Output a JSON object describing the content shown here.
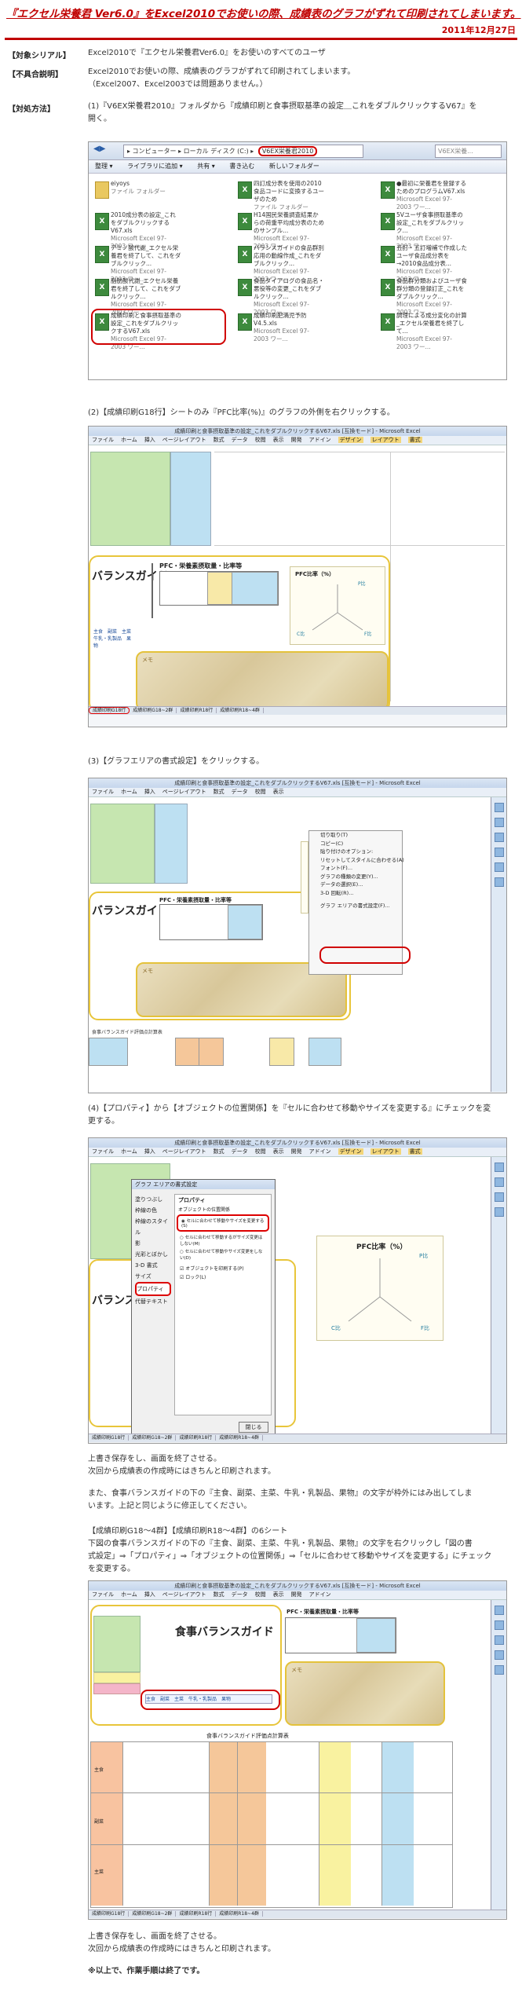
{
  "header": {
    "title": "『エクセル栄養君 Ver6.0』をExcel2010でお使いの際、成績表のグラフがずれて印刷されてしまいます。",
    "date": "2011年12月27日"
  },
  "sections": {
    "target_label": "【対象シリアル】",
    "target_text": "Excel2010で『エクセル栄養君Ver6.0』をお使いのすべてのユーザ",
    "symptom_label": "【不具合説明】",
    "symptom_line1": "Excel2010でお使いの際、成績表のグラフがずれて印刷されてしまいます。",
    "symptom_line2": "（Excel2007、Excel2003では問題ありません。）",
    "method_label": "【対処方法】",
    "step1_line1": "(1)『V6EX栄養君2010』フォルダから『成績印刷と食事摂取基準の設定＿これをダブルクリックするV67』を",
    "step1_line2": "開く。",
    "step2": "(2)【成績印刷G18行】シートのみ『PFC比率(%)』のグラフの外側を右クリックする。",
    "step3": "(3)【グラフエリアの書式設定】をクリックする。",
    "step4_line1": "(4)【プロパティ】から【オブジェクトの位置関係】を『セルに合わせて移動やサイズを変更する』にチェックを変",
    "step4_line2": "更する。",
    "after4_line1": "上書き保存をし、画面を終了させる。",
    "after4_line2": "次回から成績表の作成時にはきちんと印刷されます。",
    "also_line1": "また、食事バランスガイドの下の『主食、副菜、主菜、牛乳・乳製品、果物』の文字が枠外にはみ出してしま",
    "also_line2": "います。上記と同じように修正してください。",
    "sheets_heading": "【成績印刷G18～4群】【成績印刷R18～4群】の6シート",
    "sheets_line1": "下図の食事バランスガイドの下の『主食、副菜、主菜、牛乳・乳製品、果物』の文字を右クリックし「図の書",
    "sheets_line2": "式設定」⇒「プロパティ」⇒「オブジェクトの位置関係」⇒「セルに合わせて移動やサイズを変更する」にチェック",
    "sheets_line3": "を変更する。",
    "final_line1": "上書き保存をし、画面を終了させる。",
    "final_line2": "次回から成績表の作成時にはきちんと印刷されます。",
    "end": "※以上で、作業手順は終了です。"
  },
  "explorer": {
    "breadcrumb": "▸ コンピューター ▸ ローカル ディスク (C:) ▸",
    "folder": "V6EX栄養君2010",
    "search_placeholder": "V6EX栄養...",
    "toolbar": [
      "整理 ▾",
      "ライブラリに追加 ▾",
      "共有 ▾",
      "書き込む",
      "新しいフォルダー"
    ],
    "files": [
      {
        "name": "eiyoys",
        "type": "ファイル フォルダー",
        "icon": "folder-icon"
      },
      {
        "name": "2010成分表の設定_これをダブルクリックするV67.xls",
        "type": "Microsoft Excel 97-2003 ワー...",
        "icon": "excel-icon"
      },
      {
        "name": "アミノ酸代謝_エクセル栄養君を終了して、これをダブルクリック...",
        "type": "Microsoft Excel 97-2003 ワー...",
        "icon": "excel-icon"
      },
      {
        "name": "脂肪酸代謝_エクセル栄養君を終了して、これをダブルクリック...",
        "type": "Microsoft Excel 97-2003 ワー...",
        "icon": "excel-icon"
      },
      {
        "name": "成績印刷と食事摂取基準の設定_これをダブルクリックするV67.xls",
        "type": "Microsoft Excel 97-2003 ワー...",
        "icon": "excel-icon"
      },
      {
        "name": "四訂成分表を使用の2010食品コードに変換するユーザのため",
        "type": "ファイル フォルダー",
        "icon": "excel-icon"
      },
      {
        "name": "H14国民栄養調査結果からの荷重平均成分表のためのサンプル...",
        "type": "Microsoft Excel 97-2003 ワー...",
        "icon": "excel-icon"
      },
      {
        "name": "バランスガイドの食品群別応用の動線作成_これをダブルクリック...",
        "type": "Microsoft Excel 97-2003 ワー...",
        "icon": "excel-icon"
      },
      {
        "name": "食品ダイアログの食品名・悪役等の変更_これをダブルクリック...",
        "type": "Microsoft Excel 97-2003 ワー...",
        "icon": "excel-icon"
      },
      {
        "name": "成績印刷肥満児予防V4.5.xls",
        "type": "Microsoft Excel 97-2003 ワー...",
        "icon": "excel-icon"
      },
      {
        "name": "●最初に栄養君を登録するためのプログラムV67.xls",
        "type": "Microsoft Excel 97-2003 ワー...",
        "icon": "excel-icon"
      },
      {
        "name": "5Vユーザ食事摂取基準の設定_これをダブルクリック...",
        "type": "Microsoft Excel 97-2003 ワー...",
        "icon": "excel-icon"
      },
      {
        "name": "五訂・五訂増補で作成したユーザ食品成分表を→2010食品成分表...",
        "type": "Microsoft Excel 97-2003 ワー...",
        "icon": "excel-icon"
      },
      {
        "name": "食品群分類およびユーザ食群分類の登録訂正_これをダブルクリック...",
        "type": "Microsoft Excel 97-2003 ワー...",
        "icon": "excel-icon"
      },
      {
        "name": "調理による成分変化の計算_エクセル栄養君を終了して...",
        "type": "Microsoft Excel 97-2003 ワー...",
        "icon": "excel-icon"
      }
    ]
  },
  "excel": {
    "window_title": "成績印刷と食事摂取基準の設定_これをダブルクリックするV67.xls [互換モード] - Microsoft Excel",
    "menu": [
      "ファイル",
      "ホーム",
      "挿入",
      "ページレイアウト",
      "数式",
      "データ",
      "校閲",
      "表示",
      "開発",
      "アドイン",
      "デザイン",
      "レイアウト",
      "書式"
    ],
    "balance_guide_partial": "バランスガイド",
    "balance_guide_full": "食事バランスガイド",
    "pfc_table_title": "PFC・栄養素摂取量・比率等",
    "pfc_chart_title": "PFC比率（%）",
    "pfc_p": "P比",
    "pfc_f": "F比",
    "pfc_c": "C比",
    "memo": "メモ",
    "categories": "主食　副菜　主菜　牛乳・乳製品　果物",
    "sheet_tabs": [
      "成績印刷G18行",
      "成績印刷G18~2群",
      "成績印刷R18行",
      "成績印刷R18~4群"
    ],
    "context_menu": [
      "切り取り(T)",
      "コピー(C)",
      "貼り付けのオプション:",
      "リセットしてスタイルに合わせる(A)",
      "フォント(F)...",
      "グラフの種類の変更(Y)...",
      "データの選択(E)...",
      "3-D 回転(R)...",
      "グラフ エリアの書式設定(F)..."
    ],
    "dialog_title": "グラフ エリアの書式設定",
    "dialog_left": [
      "塗りつぶし",
      "枠線の色",
      "枠線のスタイル",
      "影",
      "光彩とぼかし",
      "3-D 書式",
      "サイズ",
      "プロパティ",
      "代替テキスト"
    ],
    "dialog_heading": "プロパティ",
    "dialog_subheading": "オブジェクトの位置関係",
    "dialog_options": [
      "セルに合わせて移動やサイズを変更する(S)",
      "セルに合わせて移動するがサイズ変更はしない(M)",
      "セルに合わせて移動やサイズ変更をしない(D)"
    ],
    "dialog_print": "オブジェクトを印刷する(P)",
    "dialog_lock": "ロック(L)",
    "dialog_close": "閉じる",
    "balance_table_title": "食事バランスガイド評価点計算表",
    "balance_row_labels": [
      "主食",
      "副菜",
      "主菜"
    ]
  },
  "colors": {
    "accent": "#c00000",
    "highlight_ellipse": "#d00000",
    "guide_border": "#e8c53a",
    "cell_green": "#c6e6b0",
    "cell_blue": "#bde0f2",
    "cell_orange": "#f5c79a"
  }
}
